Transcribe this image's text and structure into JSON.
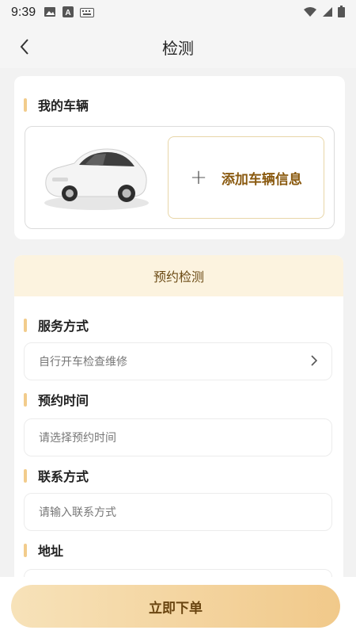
{
  "status_bar": {
    "time": "9:39",
    "icons": [
      "image-icon",
      "a-icon",
      "keyboard-icon",
      "wifi-icon",
      "signal-icon",
      "battery-icon"
    ]
  },
  "nav": {
    "title": "检测",
    "back_icon": "chevron-left-icon"
  },
  "my_vehicle": {
    "title": "我的车辆",
    "add_label": "添加车辆信息",
    "add_icon": "plus-icon",
    "car_icon": "car-icon"
  },
  "booking": {
    "header": "预约检测",
    "service": {
      "label": "服务方式",
      "value": "自行开车检查维修"
    },
    "time": {
      "label": "预约时间",
      "placeholder": "请选择预约时间"
    },
    "contact": {
      "label": "联系方式",
      "placeholder": "请输入联系方式"
    },
    "address": {
      "label": "地址"
    }
  },
  "footer": {
    "order_label": "立即下单"
  },
  "colors": {
    "accent": "#f2cc8c",
    "brand_text": "#8a5a10",
    "header_bg": "#fcf3df"
  }
}
